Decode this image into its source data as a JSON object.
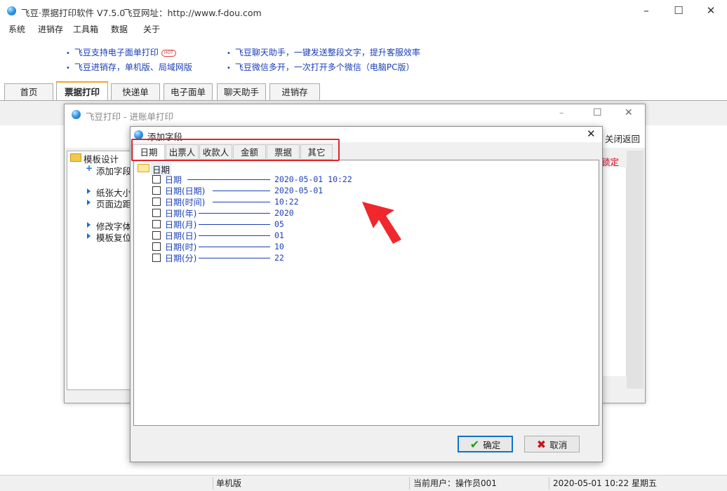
{
  "app": {
    "title": "飞豆·票据打印软件 V7.5.0",
    "site_label": "飞豆网址：http://www.f-dou.com"
  },
  "menu": [
    "系统",
    "进销存",
    "工具箱",
    "数据",
    "关于"
  ],
  "promos": {
    "left": [
      "飞豆支持电子面单打印",
      "飞豆进销存，单机版、局域网版"
    ],
    "right": [
      "飞豆聊天助手，一键发送整段文字，提升客服效率",
      "飞豆微信多开，一次打开多个微信（电脑PC版）"
    ],
    "hot_badge": "HOT"
  },
  "tabs": [
    "首页",
    "票据打印",
    "快递单",
    "电子面单",
    "聊天助手",
    "进销存"
  ],
  "active_tab": "票据打印",
  "sub_window": {
    "title": "飞豆打印 - 进账单打印",
    "close_return": "关闭返回",
    "lock_label": "锁定",
    "tree": {
      "root": "模板设计",
      "add_field": "添加字段",
      "paper_size": "纸张大小",
      "page_margin": "页面边距",
      "change_font": "修改字体",
      "template_reset": "模板复位"
    }
  },
  "dialog": {
    "title": "添加字段",
    "tabs": [
      "日期",
      "出票人",
      "收款人",
      "金额",
      "票据",
      "其它"
    ],
    "active_tab": "日期",
    "folder": "日期",
    "fields": [
      {
        "name": "日期",
        "value": "2020-05-01 10:22",
        "checked": false
      },
      {
        "name": "日期(日期)",
        "value": "2020-05-01",
        "checked": false
      },
      {
        "name": "日期(时间)",
        "value": "10:22",
        "checked": false
      },
      {
        "name": "日期(年)",
        "value": "2020",
        "checked": false
      },
      {
        "name": "日期(月)",
        "value": "05",
        "checked": false
      },
      {
        "name": "日期(日)",
        "value": "01",
        "checked": false
      },
      {
        "name": "日期(时)",
        "value": "10",
        "checked": false
      },
      {
        "name": "日期(分)",
        "value": "22",
        "checked": false
      }
    ],
    "ok_label": "确定",
    "cancel_label": "取消"
  },
  "status": {
    "edition": "单机版",
    "current_user": "当前用户：操作员001",
    "datetime": "2020-05-01 10:22 星期五"
  },
  "colors": {
    "link_blue": "#1a3fb8",
    "highlight_red": "#e0242a",
    "tab_accent": "#f5a623",
    "ok_green": "#1aa01a",
    "cancel_red": "#c8141a"
  }
}
